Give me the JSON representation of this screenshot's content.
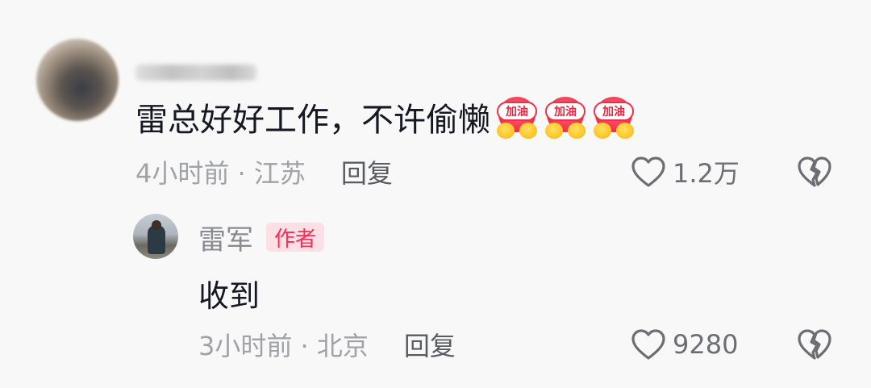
{
  "comment": {
    "text": "雷总好好工作，不许偷懒",
    "emojis": [
      {
        "icon": "jiayou-emoji",
        "label": "加油"
      },
      {
        "icon": "jiayou-emoji",
        "label": "加油"
      },
      {
        "icon": "jiayou-emoji",
        "label": "加油"
      }
    ],
    "meta": "4小时前 · 江苏",
    "reply_label": "回复",
    "like_count": "1.2万"
  },
  "reply": {
    "name": "雷军",
    "badge": "作者",
    "text": "收到",
    "meta": "3小时前 · 北京",
    "reply_label": "回复",
    "like_count": "9280"
  },
  "colors": {
    "accent": "#fe2c55",
    "badge_bg": "#fde0e5",
    "text_primary": "#161823",
    "text_secondary": "#a1a2a7"
  }
}
